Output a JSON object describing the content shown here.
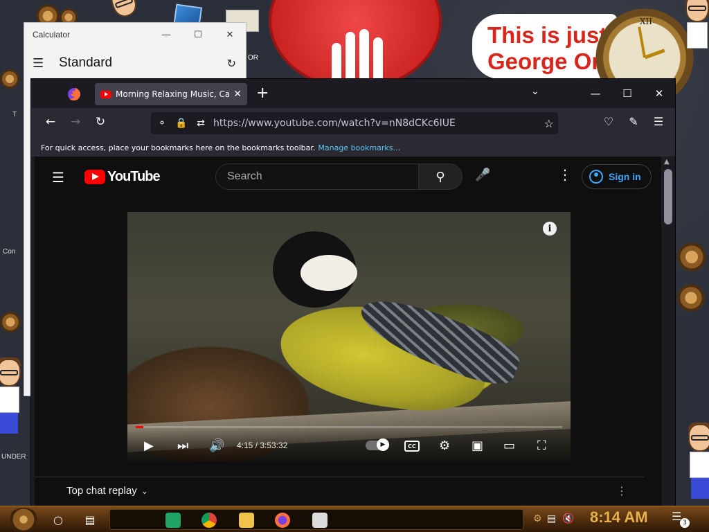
{
  "desktop": {
    "meme_line1": "This is just",
    "meme_line2": "George Or",
    "left_labels": [
      "T",
      "Con",
      "UNDER"
    ],
    "clock_numeral": "XII",
    "partial_label": "OR"
  },
  "calculator": {
    "title": "Calculator",
    "mode": "Standard"
  },
  "firefox": {
    "tab_title": "Morning Relaxing Music, Calm",
    "url": "https://www.youtube.com/watch?v=nN8dCKc6IUE",
    "bookmarks_hint": "For quick access, place your bookmarks here on the bookmarks toolbar.",
    "bookmarks_link": "Manage bookmarks…"
  },
  "youtube": {
    "logo_text": "YouTube",
    "search_placeholder": "Search",
    "sign_in": "Sign in",
    "time": "4:15 / 3:53:32",
    "progress": 0.018,
    "chat_replay": "Top chat replay",
    "cc_label": "CC"
  },
  "taskbar": {
    "time": "8:14 AM",
    "notifications": "3"
  },
  "colors": {
    "yt_red": "#ff0000",
    "ff_bg": "#1c1b22",
    "link": "#5ac8f5",
    "clock": "#e8b04a"
  }
}
